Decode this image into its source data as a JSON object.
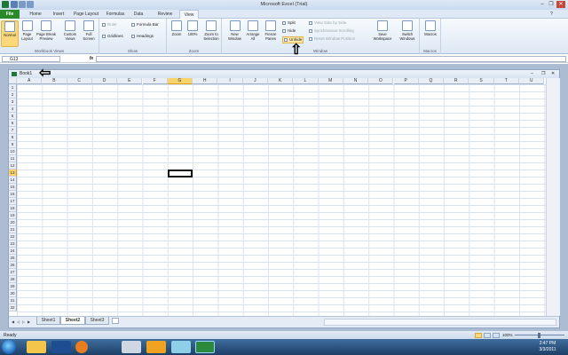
{
  "window": {
    "title": "Microsoft Excel (Trial)",
    "minimize": "–",
    "restore": "❐",
    "close": "✕"
  },
  "tabs": [
    "File",
    "Home",
    "Insert",
    "Page Layout",
    "Formulas",
    "Data",
    "Review",
    "View"
  ],
  "active_tab": "View",
  "ribbon": {
    "workbook_views": {
      "label": "Workbook Views",
      "buttons": [
        "Normal",
        "Page Layout",
        "Page Break Preview",
        "Custom Views",
        "Full Screen"
      ]
    },
    "show": {
      "label": "Show",
      "ruler": "Ruler",
      "gridlines": "Gridlines",
      "formula_bar": "Formula Bar",
      "headings": "Headings"
    },
    "zoom": {
      "label": "Zoom",
      "buttons": [
        "Zoom",
        "100%",
        "Zoom to Selection"
      ]
    },
    "window": {
      "label": "Window",
      "buttons": [
        "New Window",
        "Arrange All",
        "Freeze Panes"
      ],
      "split": "Split",
      "hide": "Hide",
      "unhide": "Unhide",
      "side_by_side": "View Side by Side",
      "sync_scroll": "Synchronous Scrolling",
      "reset_pos": "Reset Window Position",
      "save_ws": "Save Workspace",
      "switch": "Switch Windows"
    },
    "macros": {
      "label": "Macros",
      "button": "Macros"
    }
  },
  "formula_bar": {
    "name_box": "G13",
    "fx": "fx",
    "value": ""
  },
  "workbook": {
    "title": "Book1"
  },
  "columns": [
    "A",
    "B",
    "C",
    "D",
    "E",
    "F",
    "G",
    "H",
    "I",
    "J",
    "K",
    "L",
    "M",
    "N",
    "O",
    "P",
    "Q",
    "R",
    "S",
    "T",
    "U"
  ],
  "selected_column": "G",
  "rows": [
    "1",
    "2",
    "3",
    "4",
    "5",
    "6",
    "7",
    "8",
    "9",
    "10",
    "11",
    "12",
    "13",
    "14",
    "15",
    "16",
    "17",
    "18",
    "19",
    "20",
    "21",
    "22",
    "23",
    "24",
    "25",
    "26",
    "27",
    "28",
    "29",
    "30",
    "31",
    "32"
  ],
  "selected_row": "13",
  "sheets": [
    "Sheet1",
    "Sheet2",
    "Sheet3"
  ],
  "active_sheet": "Sheet2",
  "status": {
    "ready": "Ready",
    "zoom": "100%"
  },
  "clock": {
    "time": "2:47 PM",
    "date": "3/3/2011"
  },
  "arrows": {
    "left": "⇦",
    "up": "⇧"
  }
}
